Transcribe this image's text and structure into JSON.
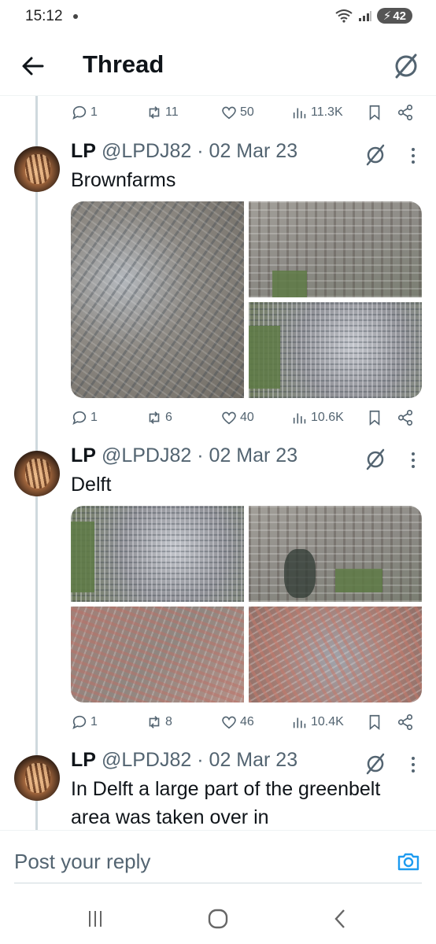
{
  "status": {
    "time": "15:12",
    "battery": "42"
  },
  "header": {
    "title": "Thread"
  },
  "top_actions": {
    "replies": "1",
    "reposts": "11",
    "likes": "50",
    "views": "11.3K"
  },
  "tweets": [
    {
      "name": "LP",
      "handle": "@LPDJ82",
      "date": "· 02 Mar 23",
      "text": "Brownfarms",
      "actions": {
        "replies": "1",
        "reposts": "6",
        "likes": "40",
        "views": "10.6K"
      }
    },
    {
      "name": "LP",
      "handle": "@LPDJ82",
      "date": "· 02 Mar 23",
      "text": "Delft",
      "actions": {
        "replies": "1",
        "reposts": "8",
        "likes": "46",
        "views": "10.4K"
      }
    },
    {
      "name": "LP",
      "handle": "@LPDJ82",
      "date": "· 02 Mar 23",
      "text": "In Delft a large part of the greenbelt area was taken over in"
    }
  ],
  "reply": {
    "placeholder": "Post your reply"
  },
  "colors": {
    "text": "#0f1419",
    "secondary": "#536471",
    "accent": "#1d9bf0",
    "divider": "#cfd9de"
  },
  "icons": [
    "back-arrow-icon",
    "grok-icon",
    "reply-icon",
    "repost-icon",
    "like-icon",
    "views-icon",
    "bookmark-icon",
    "share-icon",
    "more-icon",
    "camera-icon",
    "recents-icon",
    "home-icon",
    "back-icon"
  ]
}
